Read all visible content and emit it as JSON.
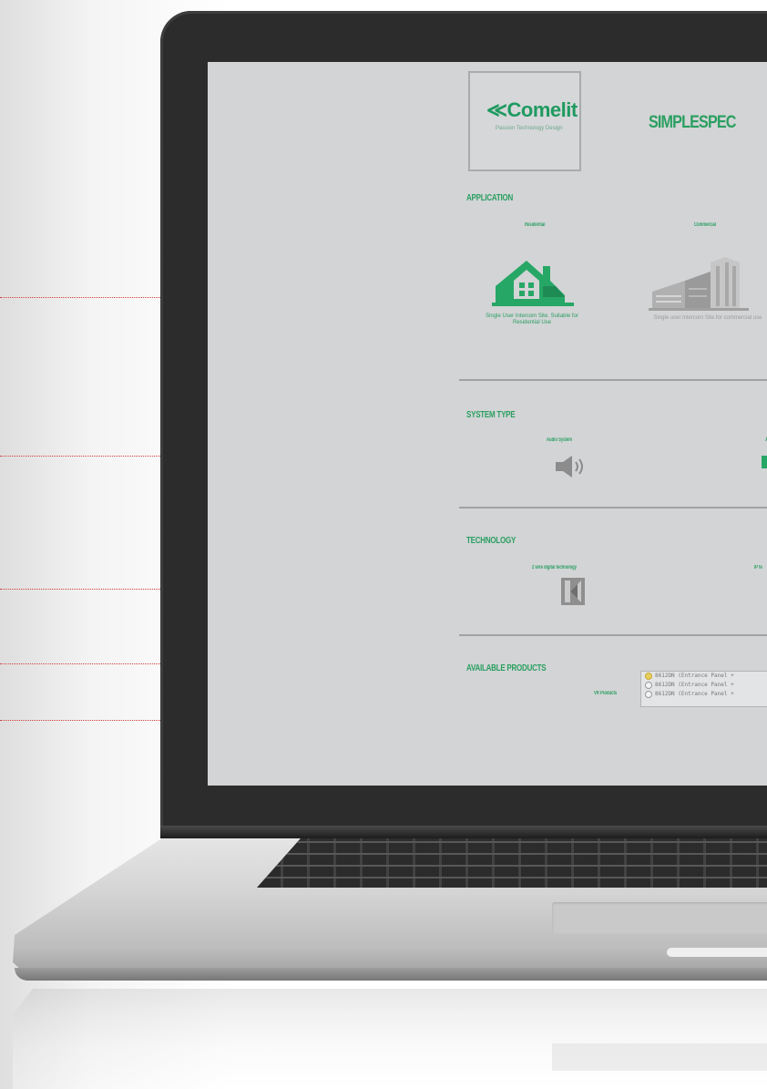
{
  "header": {
    "logo_text": "≪Comelit",
    "logo_tagline": "Passion Technology Design",
    "app_title": "SIMPLESPEC"
  },
  "application": {
    "title": "APPLICATION",
    "options": [
      {
        "label": "Residential",
        "caption": "Single User Intercom Site. Suitable for Residential Use",
        "icon": "house-icon",
        "selected": true
      },
      {
        "label": "Commercial",
        "caption": "Single user intercom Site for commercial use",
        "icon": "building-icon",
        "selected": false
      }
    ]
  },
  "system_type": {
    "title": "SYSTEM TYPE",
    "options": [
      {
        "label": "Audio System",
        "icon": "speaker-icon"
      },
      {
        "label": "A",
        "icon": "video-icon"
      }
    ]
  },
  "technology": {
    "title": "TECHNOLOGY",
    "options": [
      {
        "label": "2 wire digital technology",
        "icon": "simplebus-icon"
      },
      {
        "label": "IP te",
        "icon": "ip-icon"
      }
    ]
  },
  "available_products": {
    "title": "AVAILABLE PRODUCTS",
    "label": "VR Products",
    "items": [
      {
        "text": "8612DN (Entrance Panel +",
        "selected": true
      },
      {
        "text": "8612DN (Entrance Panel +",
        "selected": false
      },
      {
        "text": "8612DN (Entrance Panel +",
        "selected": false
      }
    ]
  },
  "colors": {
    "accent": "#27a766",
    "screen_bg": "#d2d4d6",
    "leader_line": "#d33a3a"
  }
}
